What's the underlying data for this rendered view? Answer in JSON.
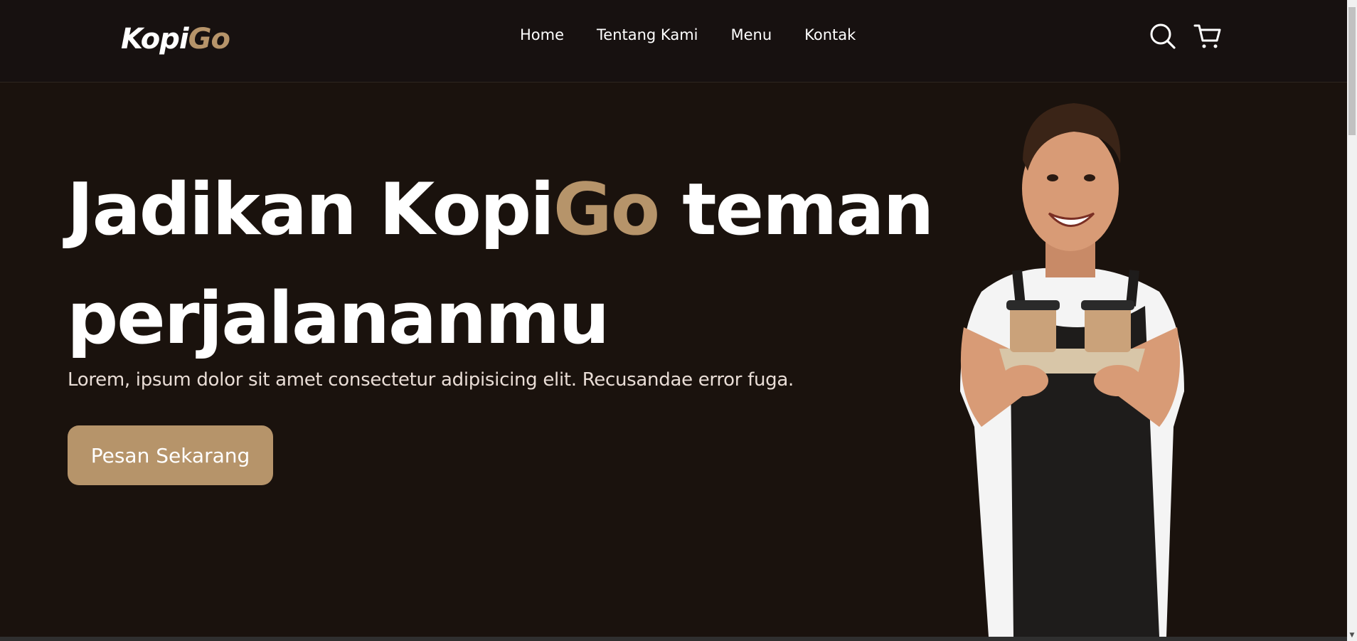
{
  "brand": {
    "logo_part1": "Kopi",
    "logo_part2": "Go",
    "accent_color": "#b6946a",
    "background_color": "#1a120d"
  },
  "nav": {
    "items": [
      {
        "label": "Home"
      },
      {
        "label": "Tentang Kami"
      },
      {
        "label": "Menu"
      },
      {
        "label": "Kontak"
      }
    ],
    "icons": [
      "search-icon",
      "cart-icon"
    ]
  },
  "hero": {
    "title_part1": "Jadikan Kopi",
    "title_accent": "Go",
    "title_part2": " teman perjalananmu",
    "subtitle": "Lorem, ipsum dolor sit amet consectetur adipisicing elit. Recusandae error fuga.",
    "cta_label": "Pesan Sekarang"
  }
}
